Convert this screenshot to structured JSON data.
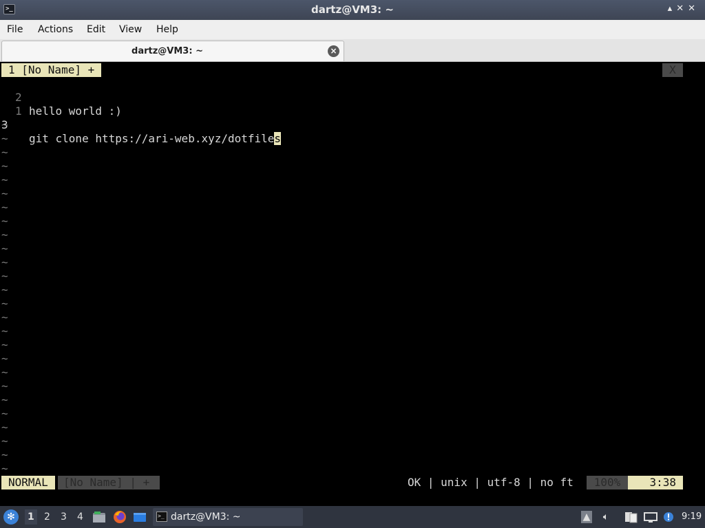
{
  "window": {
    "title": "dartz@VM3: ~",
    "controls": "▴ ✕ ✕"
  },
  "menu": [
    "File",
    "Actions",
    "Edit",
    "View",
    "Help"
  ],
  "tab": {
    "label": "dartz@VM3: ~"
  },
  "vim": {
    "buffer_tab": "1 [No Name] +",
    "buffer_tab_close": "X",
    "lines": [
      {
        "num": "2",
        "text": "hello world :)"
      },
      {
        "num": "1",
        "text": ""
      },
      {
        "num": "3",
        "text": "git clone https://ari-web.xyz/dotfile",
        "cursor": "s"
      }
    ],
    "tilde": "~",
    "status": {
      "mode": "NORMAL",
      "buffer": "[No Name] | +",
      "info": "OK | unix | utf-8 | no ft",
      "percent": "100%",
      "position": "3:38"
    }
  },
  "taskbar": {
    "workspaces": [
      "1",
      "2",
      "3",
      "4"
    ],
    "active_workspace": "1",
    "task_label": "dartz@VM3: ~",
    "clock": "9:19"
  },
  "colors": {
    "vim_highlight": "#e9e5b8",
    "taskbar": "#2f343f",
    "terminal_bg": "#000000"
  }
}
